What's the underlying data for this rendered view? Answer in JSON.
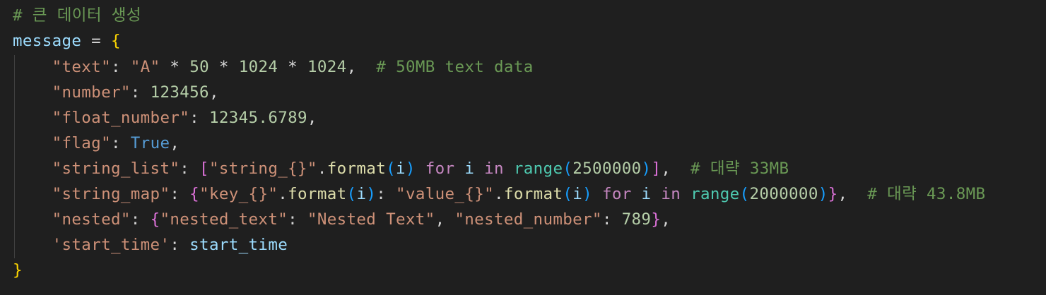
{
  "editor": {
    "theme_colors": {
      "background": "#1f1f1f",
      "comment": "#6a9955",
      "variable": "#9cdcfe",
      "string": "#ce9178",
      "number": "#b5cea8",
      "keyword": "#569cd6",
      "control": "#c586c0",
      "function": "#dcdcaa",
      "builtin": "#4ec9b0",
      "bracket_level1": "#ffd700",
      "bracket_level2": "#da70d6",
      "bracket_level3": "#179fff"
    },
    "lines": [
      [
        {
          "t": "# 큰 데이터 생성",
          "c": "t-comment"
        }
      ],
      [
        {
          "t": "message",
          "c": "t-var"
        },
        {
          "t": " = ",
          "c": "t-op"
        },
        {
          "t": "{",
          "c": "t-brace1"
        }
      ],
      [
        {
          "t": "    ",
          "c": "t-op"
        },
        {
          "t": "\"text\"",
          "c": "t-str"
        },
        {
          "t": ": ",
          "c": "t-op"
        },
        {
          "t": "\"A\"",
          "c": "t-str"
        },
        {
          "t": " * ",
          "c": "t-op"
        },
        {
          "t": "50",
          "c": "t-num"
        },
        {
          "t": " * ",
          "c": "t-op"
        },
        {
          "t": "1024",
          "c": "t-num"
        },
        {
          "t": " * ",
          "c": "t-op"
        },
        {
          "t": "1024",
          "c": "t-num"
        },
        {
          "t": ",  ",
          "c": "t-op"
        },
        {
          "t": "# 50MB text data",
          "c": "t-comment"
        }
      ],
      [
        {
          "t": "    ",
          "c": "t-op"
        },
        {
          "t": "\"number\"",
          "c": "t-str"
        },
        {
          "t": ": ",
          "c": "t-op"
        },
        {
          "t": "123456",
          "c": "t-num"
        },
        {
          "t": ",",
          "c": "t-op"
        }
      ],
      [
        {
          "t": "    ",
          "c": "t-op"
        },
        {
          "t": "\"float_number\"",
          "c": "t-str"
        },
        {
          "t": ": ",
          "c": "t-op"
        },
        {
          "t": "12345.6789",
          "c": "t-num"
        },
        {
          "t": ",",
          "c": "t-op"
        }
      ],
      [
        {
          "t": "    ",
          "c": "t-op"
        },
        {
          "t": "\"flag\"",
          "c": "t-str"
        },
        {
          "t": ": ",
          "c": "t-op"
        },
        {
          "t": "True",
          "c": "t-kw"
        },
        {
          "t": ",",
          "c": "t-op"
        }
      ],
      [
        {
          "t": "    ",
          "c": "t-op"
        },
        {
          "t": "\"string_list\"",
          "c": "t-str"
        },
        {
          "t": ": ",
          "c": "t-op"
        },
        {
          "t": "[",
          "c": "t-brace2"
        },
        {
          "t": "\"string_{}\"",
          "c": "t-str"
        },
        {
          "t": ".",
          "c": "t-op"
        },
        {
          "t": "format",
          "c": "t-fn"
        },
        {
          "t": "(",
          "c": "t-brace3"
        },
        {
          "t": "i",
          "c": "t-var"
        },
        {
          "t": ")",
          "c": "t-brace3"
        },
        {
          "t": " ",
          "c": "t-op"
        },
        {
          "t": "for",
          "c": "t-ctl"
        },
        {
          "t": " ",
          "c": "t-op"
        },
        {
          "t": "i",
          "c": "t-var"
        },
        {
          "t": " ",
          "c": "t-op"
        },
        {
          "t": "in",
          "c": "t-ctl"
        },
        {
          "t": " ",
          "c": "t-op"
        },
        {
          "t": "range",
          "c": "t-builtin"
        },
        {
          "t": "(",
          "c": "t-brace3"
        },
        {
          "t": "2500000",
          "c": "t-num"
        },
        {
          "t": ")",
          "c": "t-brace3"
        },
        {
          "t": "]",
          "c": "t-brace2"
        },
        {
          "t": ",  ",
          "c": "t-op"
        },
        {
          "t": "# 대략 33MB",
          "c": "t-comment"
        }
      ],
      [
        {
          "t": "    ",
          "c": "t-op"
        },
        {
          "t": "\"string_map\"",
          "c": "t-str"
        },
        {
          "t": ": ",
          "c": "t-op"
        },
        {
          "t": "{",
          "c": "t-brace2"
        },
        {
          "t": "\"key_{}\"",
          "c": "t-str"
        },
        {
          "t": ".",
          "c": "t-op"
        },
        {
          "t": "format",
          "c": "t-fn"
        },
        {
          "t": "(",
          "c": "t-brace3"
        },
        {
          "t": "i",
          "c": "t-var"
        },
        {
          "t": ")",
          "c": "t-brace3"
        },
        {
          "t": ": ",
          "c": "t-op"
        },
        {
          "t": "\"value_{}\"",
          "c": "t-str"
        },
        {
          "t": ".",
          "c": "t-op"
        },
        {
          "t": "format",
          "c": "t-fn"
        },
        {
          "t": "(",
          "c": "t-brace3"
        },
        {
          "t": "i",
          "c": "t-var"
        },
        {
          "t": ")",
          "c": "t-brace3"
        },
        {
          "t": " ",
          "c": "t-op"
        },
        {
          "t": "for",
          "c": "t-ctl"
        },
        {
          "t": " ",
          "c": "t-op"
        },
        {
          "t": "i",
          "c": "t-var"
        },
        {
          "t": " ",
          "c": "t-op"
        },
        {
          "t": "in",
          "c": "t-ctl"
        },
        {
          "t": " ",
          "c": "t-op"
        },
        {
          "t": "range",
          "c": "t-builtin"
        },
        {
          "t": "(",
          "c": "t-brace3"
        },
        {
          "t": "2000000",
          "c": "t-num"
        },
        {
          "t": ")",
          "c": "t-brace3"
        },
        {
          "t": "}",
          "c": "t-brace2"
        },
        {
          "t": ",  ",
          "c": "t-op"
        },
        {
          "t": "# 대략 43.8MB",
          "c": "t-comment"
        }
      ],
      [
        {
          "t": "    ",
          "c": "t-op"
        },
        {
          "t": "\"nested\"",
          "c": "t-str"
        },
        {
          "t": ": ",
          "c": "t-op"
        },
        {
          "t": "{",
          "c": "t-brace2"
        },
        {
          "t": "\"nested_text\"",
          "c": "t-str"
        },
        {
          "t": ": ",
          "c": "t-op"
        },
        {
          "t": "\"Nested Text\"",
          "c": "t-str"
        },
        {
          "t": ", ",
          "c": "t-op"
        },
        {
          "t": "\"nested_number\"",
          "c": "t-str"
        },
        {
          "t": ": ",
          "c": "t-op"
        },
        {
          "t": "789",
          "c": "t-num"
        },
        {
          "t": "}",
          "c": "t-brace2"
        },
        {
          "t": ",",
          "c": "t-op"
        }
      ],
      [
        {
          "t": "    ",
          "c": "t-op"
        },
        {
          "t": "'start_time'",
          "c": "t-str"
        },
        {
          "t": ": ",
          "c": "t-op"
        },
        {
          "t": "start_time",
          "c": "t-var"
        }
      ],
      [
        {
          "t": "}",
          "c": "t-brace1"
        }
      ]
    ]
  }
}
